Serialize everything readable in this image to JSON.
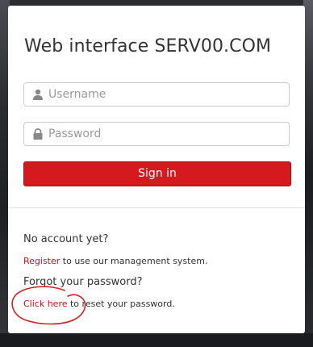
{
  "title": "Web interface SERV00.COM",
  "form": {
    "username_placeholder": "Username",
    "password_placeholder": "Password",
    "signin_label": "Sign in"
  },
  "footer": {
    "no_account": "No account yet?",
    "register_link": "Register",
    "register_rest": " to use our management system.",
    "forgot": "Forgot your password?",
    "click_here_link": "Click here",
    "click_here_rest": " to reset your password."
  },
  "icons": {
    "username": "user-icon",
    "password": "lock-icon"
  },
  "colors": {
    "accent": "#d4191f",
    "link": "#c0161d",
    "annotation": "#d42020"
  }
}
